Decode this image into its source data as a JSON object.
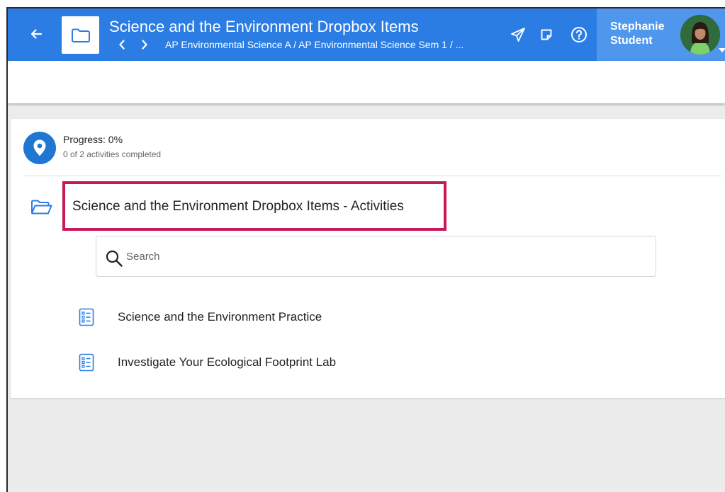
{
  "header": {
    "title": "Science and the Environment Dropbox Items",
    "breadcrumb": "AP Environmental Science A / AP Environmental Science Sem 1 / ...",
    "user": {
      "first_name": "Stephanie",
      "last_name": "Student"
    }
  },
  "icons": {
    "back": "arrow-left-icon",
    "folder": "folder-icon",
    "prev": "chevron-left-icon",
    "next": "chevron-right-icon",
    "send": "paper-plane-icon",
    "notes": "sticky-note-icon",
    "help": "help-circle-icon",
    "location": "map-pin-icon",
    "folder_open": "folder-open-icon",
    "search": "search-icon",
    "assignment": "checklist-icon"
  },
  "colors": {
    "topbar": "#2b7de3",
    "user_area": "#4f97ec",
    "highlight": "#c7195a",
    "accent": "#1f77d2"
  },
  "progress": {
    "label": "Progress: 0%",
    "value_percent": 0,
    "completed_text": "0 of 2 activities completed"
  },
  "section": {
    "title": "Science and the Environment Dropbox Items - Activities"
  },
  "search": {
    "placeholder": "Search",
    "value": ""
  },
  "activities": [
    {
      "label": "Science and the Environment Practice"
    },
    {
      "label": "Investigate Your Ecological Footprint Lab"
    }
  ]
}
